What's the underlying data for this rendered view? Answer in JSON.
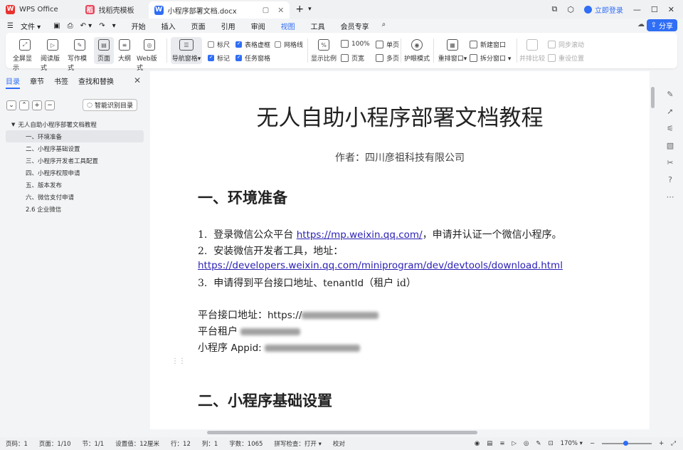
{
  "titlebar": {
    "tabs": [
      {
        "label": "WPS Office",
        "icon": "wps-logo"
      },
      {
        "label": "找稻壳模板",
        "icon": "docer-logo"
      },
      {
        "label": "小程序部署文档.docx",
        "icon": "word-doc-icon"
      }
    ],
    "login_label": "立即登录"
  },
  "menubar": {
    "file_label": "文件",
    "tabs": [
      "开始",
      "插入",
      "页面",
      "引用",
      "审阅",
      "视图",
      "工具",
      "会员专享"
    ],
    "active_tab": "视图",
    "share_label": "分享"
  },
  "ribbon": {
    "fullscreen": "全屏显示",
    "read": "阅读版式",
    "write": "写作模式",
    "page": "页面",
    "outline": "大纲",
    "web": "Web版式",
    "nav": "导航窗格",
    "ruler": "标尺",
    "mark": "标记",
    "table_grid": "表格虚框",
    "task_pane": "任务窗格",
    "grid": "网格线",
    "zoom_ratio": "显示比例",
    "percent100": "100%",
    "page_width": "页宽",
    "single_page": "单页",
    "multi_page": "多页",
    "eye_mode": "护眼模式",
    "rearrange": "重排窗口",
    "new_window": "新建窗口",
    "split_window": "拆分窗口",
    "side_compare": "并排比较",
    "sync_scroll": "同步滚动",
    "reset_pos": "重设位置"
  },
  "navpane": {
    "tabs": [
      "目录",
      "章节",
      "书签",
      "查找和替换"
    ],
    "ai_button": "智能识别目录",
    "outline": [
      {
        "label": "无人自助小程序部署文档教程",
        "level": 0
      },
      {
        "label": "一、环境准备",
        "level": 1,
        "selected": true
      },
      {
        "label": "二、小程序基础设置",
        "level": 1
      },
      {
        "label": "三、小程序开发者工具配置",
        "level": 1
      },
      {
        "label": "四、小程序权限申请",
        "level": 1
      },
      {
        "label": "五、版本发布",
        "level": 1
      },
      {
        "label": "六、微信支付申请",
        "level": 1
      },
      {
        "label": "2.6 企业微信",
        "level": 1
      }
    ]
  },
  "document": {
    "title": "无人自助小程序部署文档教程",
    "author": "作者：四川彦祖科技有限公司",
    "h1_1": "一、环境准备",
    "step1_num": "1.",
    "step1_pre": "登录微信公众平台",
    "step1_link": "https://mp.weixin.qq.com/",
    "step1_post": "，申请并认证一个微信小程序。",
    "step2_num": "2.",
    "step2_text": "安装微信开发者工具，地址：",
    "step2_link": "https://developers.weixin.qq.com/miniprogram/dev/devtools/download.html",
    "step3_num": "3.",
    "step3_pre": "申请得到平台接口地址、",
    "step3_mid": "tenantId",
    "step3_post": "（租户 id）",
    "api_label": "平台接口地址：",
    "api_prefix": "https://",
    "tenant_label": "平台租户",
    "appid_label": "小程序",
    "appid_key": "Appid:",
    "h1_2": "二、小程序基础设置"
  },
  "statusbar": {
    "page_code": "页码：1",
    "page": "页面：1/10",
    "section": "节：1/1",
    "setting": "设置值：12厘米",
    "row": "行：12",
    "col": "列：1",
    "words": "字数：1065",
    "spell": "拼写检查：打开",
    "proof": "校对",
    "zoom": "170%"
  }
}
